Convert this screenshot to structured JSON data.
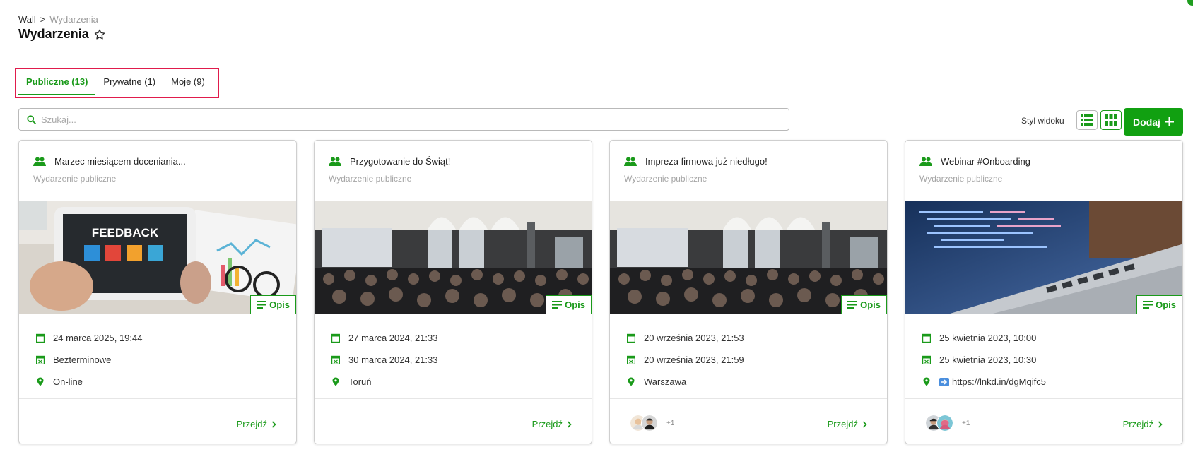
{
  "breadcrumb": {
    "root": "Wall",
    "separator": ">",
    "current": "Wydarzenia"
  },
  "page": {
    "title": "Wydarzenia"
  },
  "tabs": [
    {
      "label": "Publiczne (13)",
      "active": true
    },
    {
      "label": "Prywatne (1)",
      "active": false
    },
    {
      "label": "Moje (9)",
      "active": false
    }
  ],
  "search": {
    "placeholder": "Szukaj..."
  },
  "toolbar": {
    "view_style_label": "Styl widoku",
    "add_label": "Dodaj"
  },
  "colors": {
    "accent": "#11a011",
    "tabs_highlight": "#e01b4c"
  },
  "icons": [
    "search-icon",
    "star-icon",
    "list-view-icon",
    "grid-view-icon",
    "plus-icon",
    "group-icon",
    "calendar-start-icon",
    "calendar-end-icon",
    "location-pin-icon",
    "description-icon",
    "chevron-right-icon"
  ],
  "cards": [
    {
      "title": "Marzec miesiącem doceniania...",
      "subtitle": "Wydarzenie publiczne",
      "image": "feedback-tablet",
      "description_label": "Opis",
      "start": "24 marca 2025, 19:44",
      "end": "Bezterminowe",
      "location": "On-line",
      "participants_extra": "",
      "go_label": "Przejdź"
    },
    {
      "title": "Przygotowanie do Świąt!",
      "subtitle": "Wydarzenie publiczne",
      "image": "conference-hall",
      "description_label": "Opis",
      "start": "27 marca 2024, 21:33",
      "end": "30 marca 2024, 21:33",
      "location": "Toruń",
      "participants_extra": "",
      "go_label": "Przejdź"
    },
    {
      "title": "Impreza firmowa już niedługo!",
      "subtitle": "Wydarzenie publiczne",
      "image": "conference-hall",
      "description_label": "Opis",
      "start": "20 września 2023, 21:53",
      "end": "20 września 2023, 21:59",
      "location": "Warszawa",
      "participants_extra": "+1",
      "go_label": "Przejdź"
    },
    {
      "title": "Webinar #Onboarding",
      "subtitle": "Wydarzenie publiczne",
      "image": "laptop-code",
      "description_label": "Opis",
      "start": "25 kwietnia 2023, 10:00",
      "end": "25 kwietnia 2023, 10:30",
      "location": "https://lnkd.in/dgMqifc5",
      "participants_extra": "+1",
      "go_label": "Przejdź"
    }
  ]
}
